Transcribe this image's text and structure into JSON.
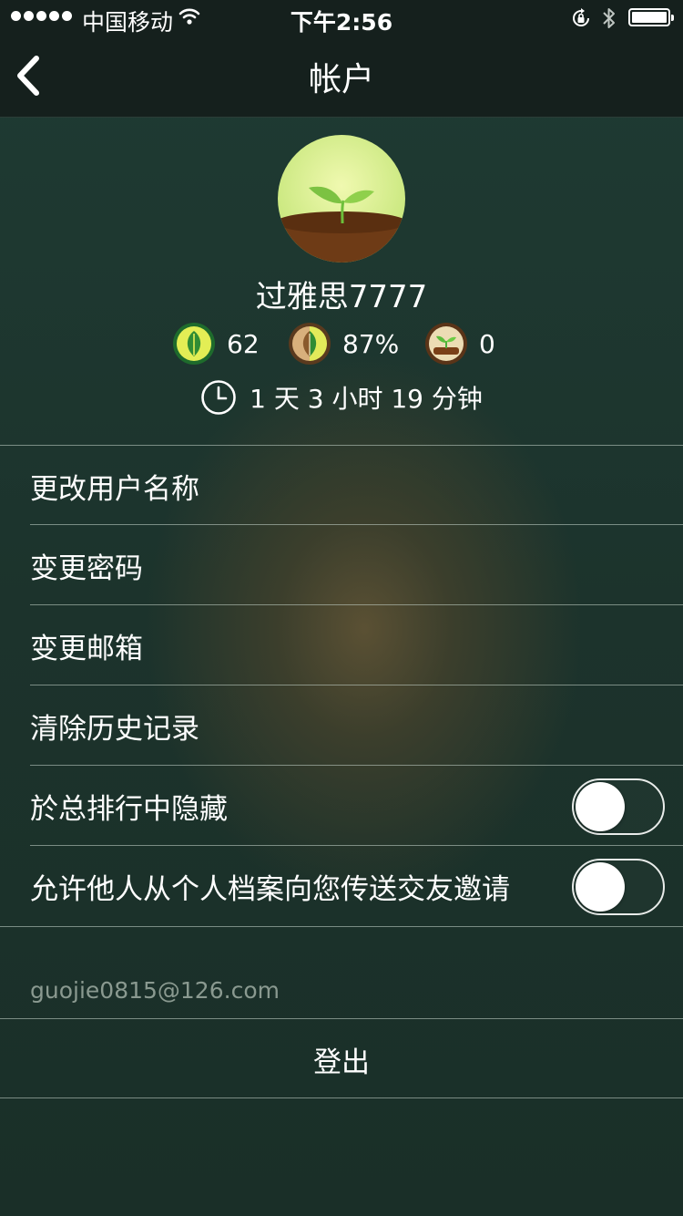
{
  "status_bar": {
    "carrier": "中国移动",
    "time": "下午2:56"
  },
  "nav": {
    "title": "帐户"
  },
  "profile": {
    "username": "过雅思7777",
    "stats": [
      {
        "icon": "green-leaf-badge-icon",
        "value": "62"
      },
      {
        "icon": "half-leaf-badge-icon",
        "value": "87%"
      },
      {
        "icon": "sprout-badge-icon",
        "value": "0"
      }
    ],
    "total_time": "1 天 3 小时 19 分钟"
  },
  "menu": [
    {
      "label": "更改用户名称"
    },
    {
      "label": "变更密码"
    },
    {
      "label": "变更邮箱"
    },
    {
      "label": "清除历史记录"
    }
  ],
  "toggles": [
    {
      "label": "於总排行中隐藏",
      "on": false
    },
    {
      "label": "允许他人从个人档案向您传送交友邀请",
      "on": false
    }
  ],
  "account": {
    "email": "guojie0815@126.com",
    "logout_label": "登出"
  },
  "colors": {
    "background": "#1d352e",
    "navbar": "#15201d",
    "leaf_green": "#7cc242",
    "soil_brown": "#6b3a17",
    "email_gray": "#8a9990"
  }
}
